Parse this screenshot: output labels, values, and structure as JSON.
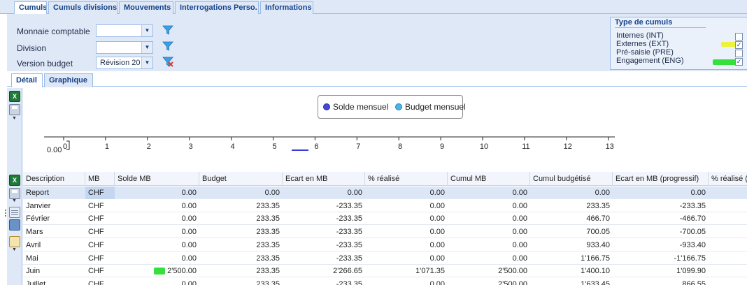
{
  "top_tabs": [
    "Cumuls",
    "Cumuls divisions",
    "Mouvements",
    "Interrogations Perso.",
    "Informations"
  ],
  "filters": {
    "monnaie_label": "Monnaie comptable",
    "monnaie_value": "",
    "division_label": "Division",
    "division_value": "",
    "version_label": "Version budget",
    "version_value": "Révision 20"
  },
  "type_cumuls": {
    "title": "Type de cumuls",
    "items": [
      {
        "label": "Internes (INT)",
        "checked": false
      },
      {
        "label": "Externes (EXT)",
        "checked": true
      },
      {
        "label": "Pré-saisie (PRE)",
        "checked": false
      },
      {
        "label": "Engagement (ENG)",
        "checked": true
      }
    ]
  },
  "sub_tabs": [
    "Détail",
    "Graphique"
  ],
  "chart_data": {
    "type": "bar",
    "categories": [
      "0",
      "1",
      "2",
      "3",
      "4",
      "5",
      "6",
      "7",
      "8",
      "9",
      "10",
      "11",
      "12",
      "13"
    ],
    "series": [
      {
        "name": "Solde mensuel",
        "color": "#4848d8",
        "values": [
          0,
          0,
          0,
          0,
          0,
          0,
          0,
          0,
          0,
          0,
          0,
          0,
          0,
          0
        ]
      },
      {
        "name": "Budget mensuel",
        "color": "#4cb5e8",
        "values": [
          0,
          0,
          0,
          0,
          0,
          0,
          0,
          0,
          0,
          0,
          0,
          0,
          0,
          0
        ]
      }
    ],
    "ytick": "0.00"
  },
  "grid": {
    "columns": [
      "Description",
      "MB",
      "Solde MB",
      "Budget",
      "Ecart en MB",
      "% réalisé",
      "Cumul MB",
      "Cumul budgétisé",
      "Ecart en MB (progressif)",
      "% réalisé (p"
    ],
    "rows": [
      [
        "Report",
        "CHF",
        "0.00",
        "0.00",
        "0.00",
        "0.00",
        "0.00",
        "0.00",
        "0.00"
      ],
      [
        "Janvier",
        "CHF",
        "0.00",
        "233.35",
        "-233.35",
        "0.00",
        "0.00",
        "233.35",
        "-233.35"
      ],
      [
        "Février",
        "CHF",
        "0.00",
        "233.35",
        "-233.35",
        "0.00",
        "0.00",
        "466.70",
        "-466.70"
      ],
      [
        "Mars",
        "CHF",
        "0.00",
        "233.35",
        "-233.35",
        "0.00",
        "0.00",
        "700.05",
        "-700.05"
      ],
      [
        "Avril",
        "CHF",
        "0.00",
        "233.35",
        "-233.35",
        "0.00",
        "0.00",
        "933.40",
        "-933.40"
      ],
      [
        "Mai",
        "CHF",
        "0.00",
        "233.35",
        "-233.35",
        "0.00",
        "0.00",
        "1'166.75",
        "-1'166.75"
      ],
      [
        "Juin",
        "CHF",
        "2'500.00",
        "233.35",
        "2'266.65",
        "1'071.35",
        "2'500.00",
        "1'400.10",
        "1'099.90"
      ],
      [
        "Juillet",
        "CHF",
        "0.00",
        "233.35",
        "-233.35",
        "0.00",
        "2'500.00",
        "1'633.45",
        "866.55"
      ]
    ]
  }
}
